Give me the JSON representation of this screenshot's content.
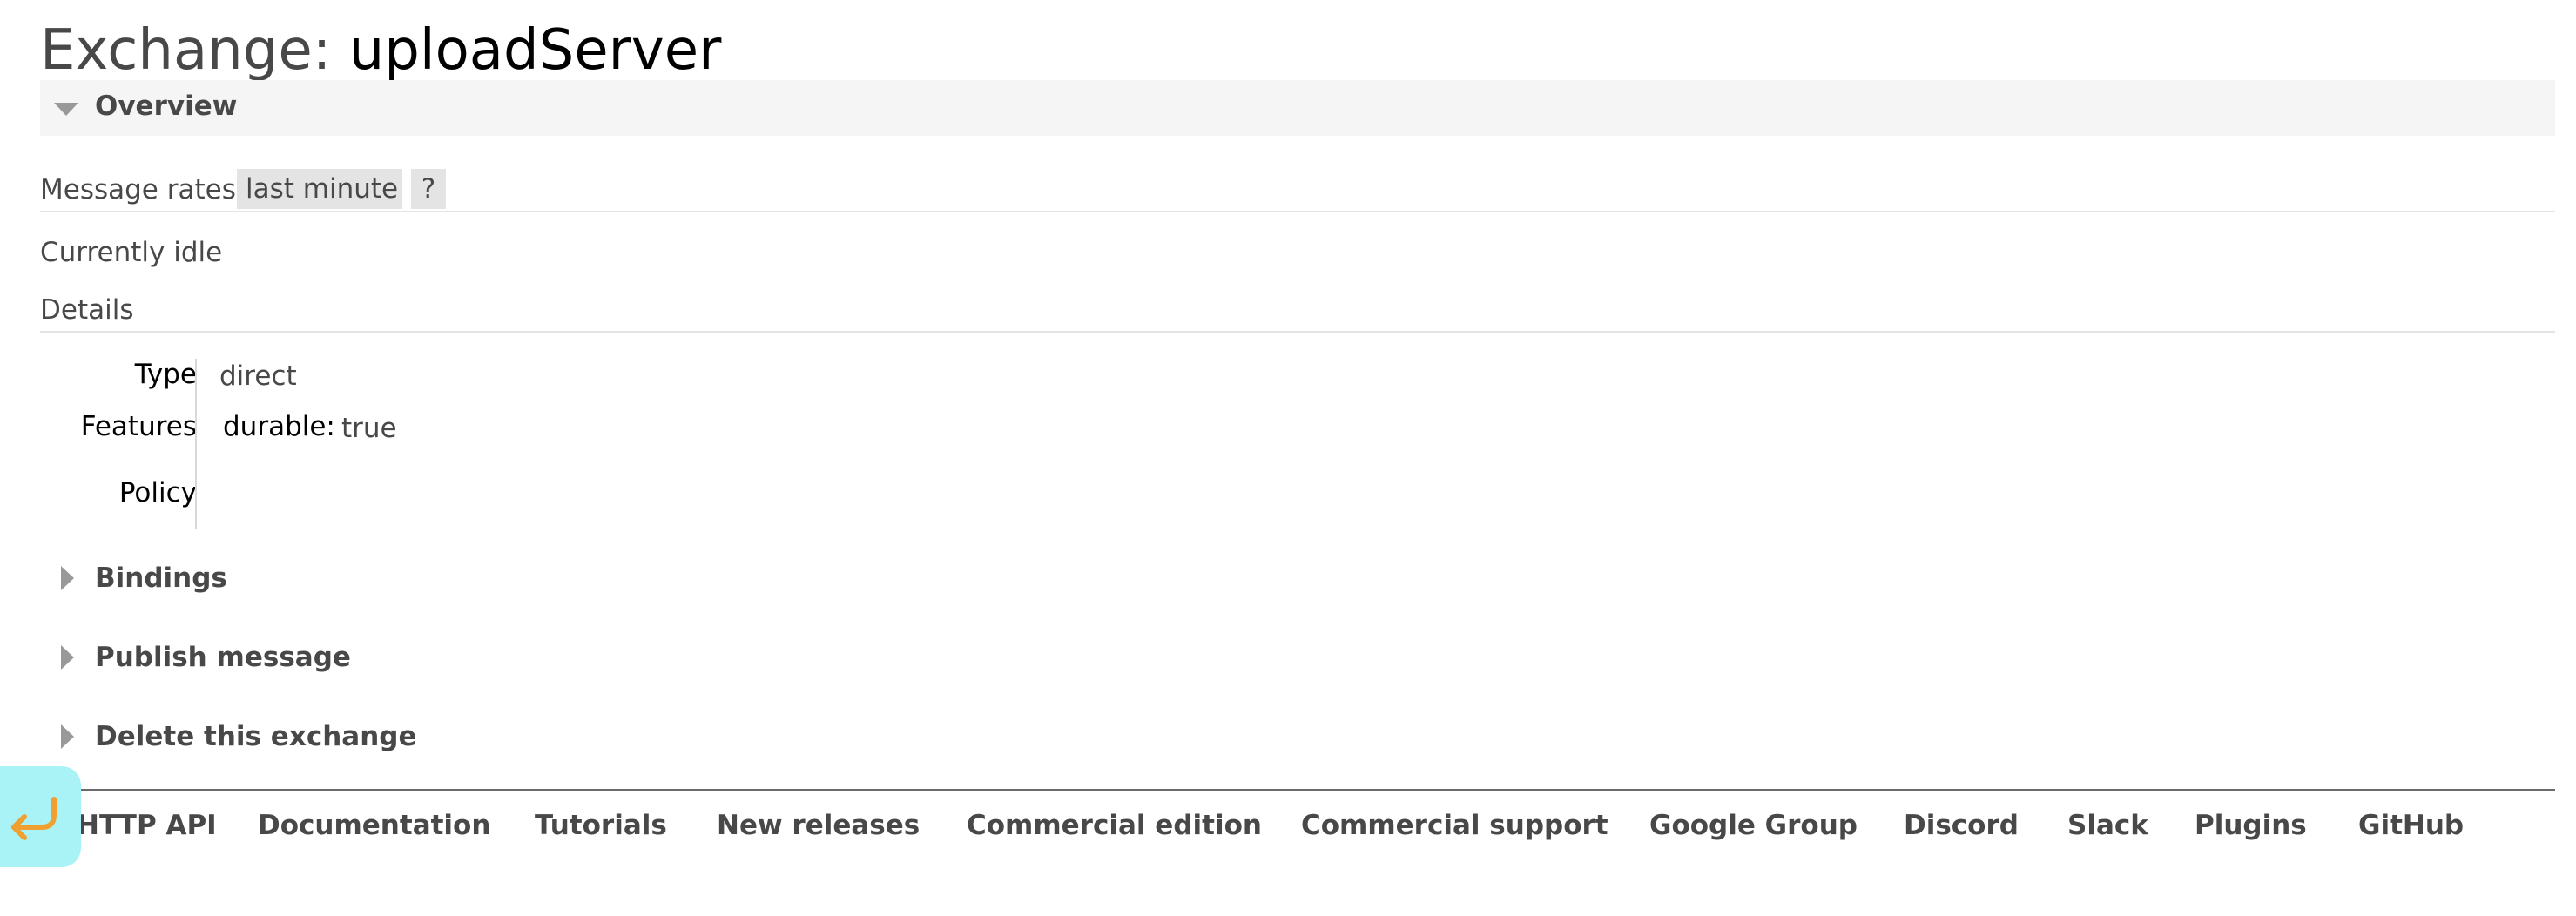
{
  "page": {
    "title_prefix": "Exchange:",
    "title_name": "uploadServer"
  },
  "overview": {
    "label": "Overview",
    "message_rates_label": "Message rates",
    "range_label": "last minute",
    "help_label": "?",
    "idle_text": "Currently idle",
    "details_label": "Details"
  },
  "details": {
    "type_key": "Type",
    "type_value": "direct",
    "features_key": "Features",
    "durable_key": "durable:",
    "durable_value": "true",
    "policy_key": "Policy"
  },
  "sections": {
    "bindings": "Bindings",
    "publish": "Publish message",
    "delete": "Delete this exchange"
  },
  "footer": {
    "links": [
      "HTTP API",
      "Documentation",
      "Tutorials",
      "New releases",
      "Commercial edition",
      "Commercial support",
      "Google Group",
      "Discord",
      "Slack",
      "Plugins",
      "GitHub"
    ]
  },
  "colors": {
    "accent_back_button": "#a9f2f5",
    "back_arrow": "#f0a030",
    "overview_bg": "#f5f5f5",
    "pill_bg": "#e4e4e4"
  },
  "icons": {
    "back": "return-arrow-icon",
    "expanded": "triangle-down-icon",
    "collapsed": "triangle-right-icon"
  }
}
